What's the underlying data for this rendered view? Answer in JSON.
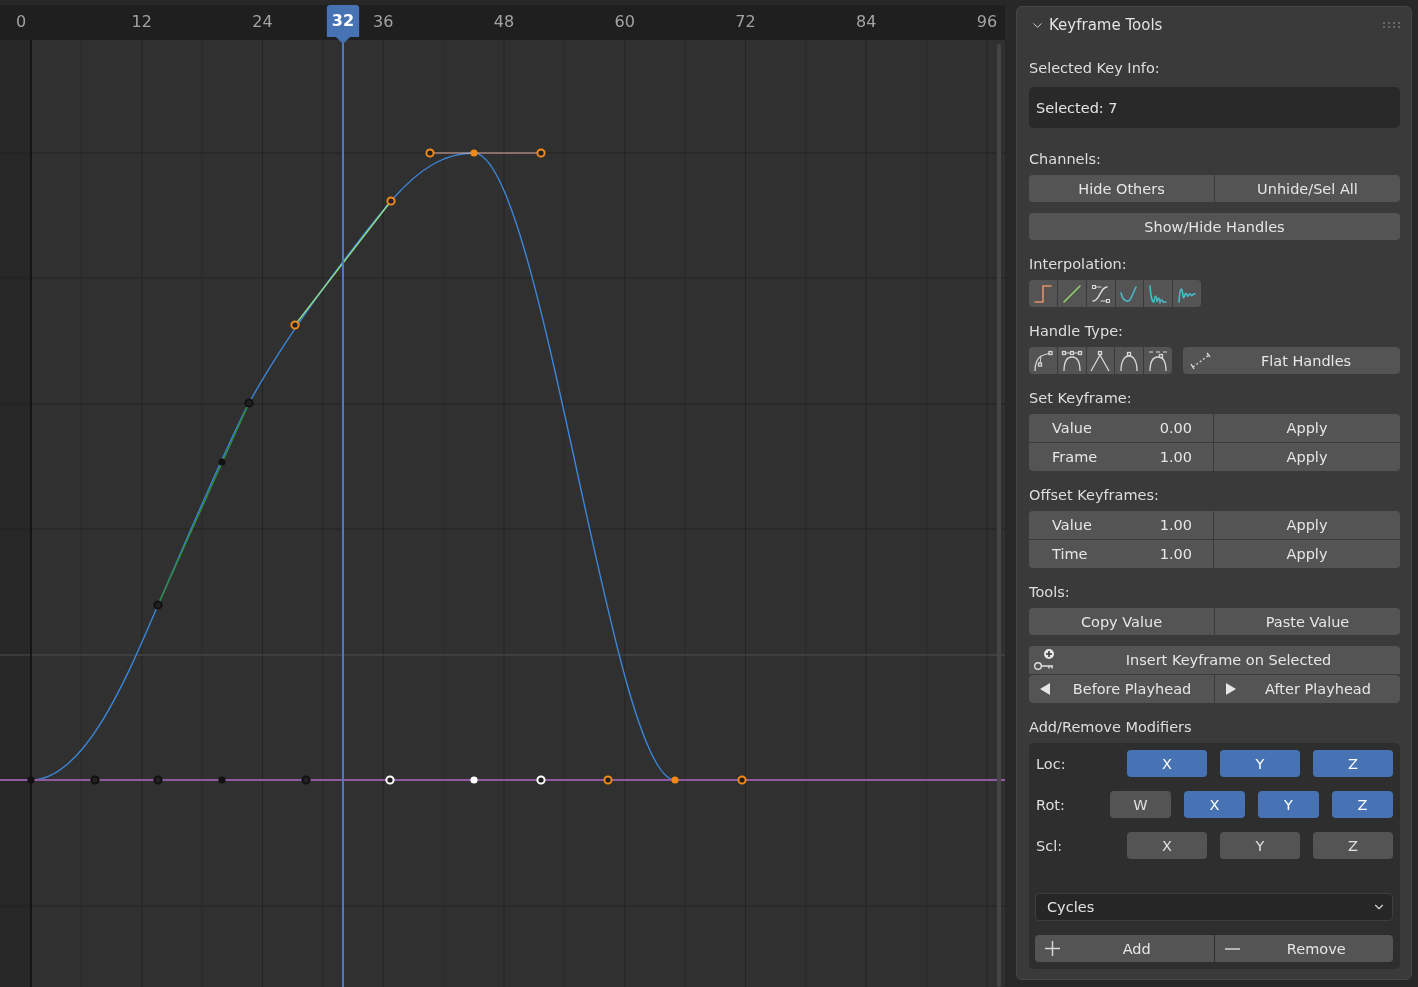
{
  "graph_editor": {
    "ruler": {
      "ticks": [
        "0",
        "12",
        "24",
        "36",
        "48",
        "60",
        "72",
        "84",
        "96"
      ],
      "playhead": "32"
    }
  },
  "panel": {
    "title": "Keyframe Tools",
    "expanded": true,
    "selected_key_info": {
      "label": "Selected Key Info:",
      "value": "Selected: 7"
    },
    "channels": {
      "label": "Channels:",
      "buttons": [
        "Hide Others",
        "Unhide/Sel All"
      ],
      "handles_button": "Show/Hide Handles"
    },
    "interpolation": {
      "label": "Interpolation:",
      "buttons": [
        {
          "kind": "constant"
        },
        {
          "kind": "linear"
        },
        {
          "kind": "bezier"
        },
        {
          "kind": "ease"
        },
        {
          "kind": "bounce"
        },
        {
          "kind": "elastic"
        }
      ]
    },
    "handle_type": {
      "label": "Handle Type:",
      "buttons": [
        {
          "kind": "free"
        },
        {
          "kind": "aligned"
        },
        {
          "kind": "vector"
        },
        {
          "kind": "automatic"
        },
        {
          "kind": "auto_clamped"
        }
      ],
      "flat_button": "Flat Handles"
    },
    "set_keyframe": {
      "label": "Set Keyframe:",
      "rows": [
        {
          "field": "Value",
          "value": "0.00",
          "button": "Apply"
        },
        {
          "field": "Frame",
          "value": "1.00",
          "button": "Apply"
        }
      ]
    },
    "offset_keyframes": {
      "label": "Offset Keyframes:",
      "rows": [
        {
          "field": "Value",
          "value": "1.00",
          "button": "Apply"
        },
        {
          "field": "Time",
          "value": "1.00",
          "button": "Apply"
        }
      ]
    },
    "tools": {
      "label": "Tools:",
      "buttons": [
        "Copy Value",
        "Paste Value"
      ],
      "insert_button": "Insert Keyframe on Selected",
      "playhead_buttons": [
        "Before Playhead",
        "After Playhead"
      ]
    },
    "modifiers": {
      "label": "Add/Remove Modifiers",
      "groups": [
        {
          "label": "Loc:",
          "toggles": [
            {
              "label": "X",
              "on": true
            },
            {
              "label": "Y",
              "on": true
            },
            {
              "label": "Z",
              "on": true
            }
          ]
        },
        {
          "label": "Rot:",
          "toggles": [
            {
              "label": "W",
              "on": false
            },
            {
              "label": "X",
              "on": true
            },
            {
              "label": "Y",
              "on": true
            },
            {
              "label": "Z",
              "on": true
            }
          ]
        },
        {
          "label": "Scl:",
          "toggles": [
            {
              "label": "X",
              "on": false
            },
            {
              "label": "Y",
              "on": false
            },
            {
              "label": "Z",
              "on": false
            }
          ]
        }
      ],
      "dropdown": "Cycles",
      "add_button": "Add",
      "remove_button": "Remove"
    }
  }
}
